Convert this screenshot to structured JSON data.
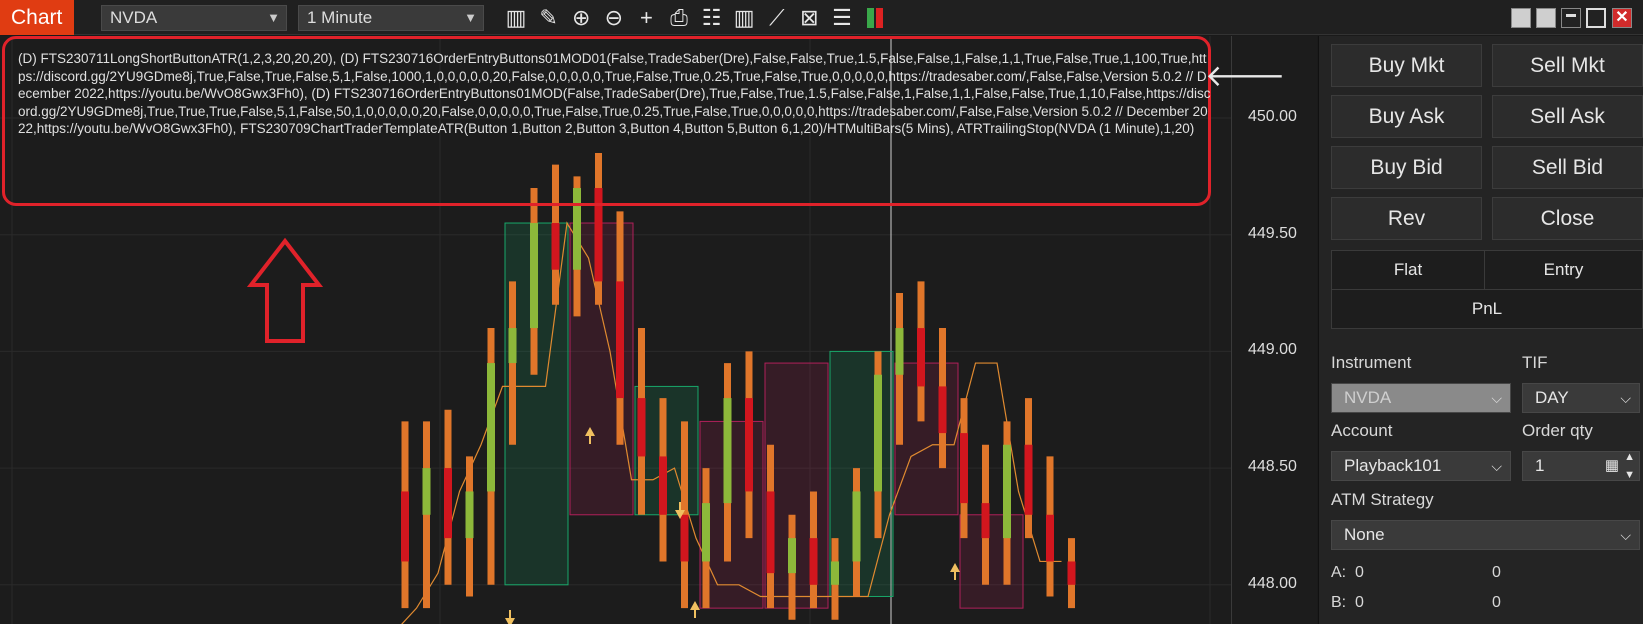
{
  "toolbar": {
    "tab_label": "Chart",
    "instrument": "NVDA",
    "period": "1 Minute",
    "icons": [
      "bar-type-icon",
      "draw-tool-icon",
      "zoom-in-icon",
      "zoom-out-icon",
      "crosshair-icon",
      "data-box-icon",
      "properties-icon",
      "indicators-icon",
      "strategies-icon",
      "templates-icon",
      "object-list-icon",
      "chart-trader-icon"
    ],
    "window_icons": [
      "minimize-icon",
      "restore-icon",
      "maximize-icon",
      "close-icon"
    ],
    "close_glyph": "✕"
  },
  "chart": {
    "indicator_text": "(D) FTS230711LongShortButtonATR(1,2,3,20,20,20), (D) FTS230716OrderEntryButtons01MOD01(False,TradeSaber(Dre),False,False,True,1.5,False,False,1,False,1,1,True,False,True,1,100,True,https://discord.gg/2YU9GDme8j,True,False,True,False,5,1,False,1000,1,0,0,0,0,0,20,False,0,0,0,0,0,True,False,True,0.25,True,False,True,0,0,0,0,0,https://tradesaber.com/,False,False,Version 5.0.2 // December 2022,https://youtu.be/WvO8Gwx3Fh0), (D) FTS230716OrderEntryButtons01MOD(False,TradeSaber(Dre),True,False,True,1.5,False,False,1,False,1,1,False,False,True,1,10,False,https://discord.gg/2YU9GDme8j,True,True,True,False,5,1,False,50,1,0,0,0,0,0,20,False,0,0,0,0,0,True,False,True,0.25,True,False,True,0,0,0,0,0,https://tradesaber.com/,False,False,Version 5.0.2 // December 2022,https://youtu.be/WvO8Gwx3Fh0), FTS230709ChartTraderTemplateATR(Button 1,Button 2,Button 3,Button 4,Button 5,Button 6,1,20)/HTMultiBars(5 Mins), ATRTrailingStop(NVDA (1 Minute),1,20)",
    "arrow_glyph": "🡐",
    "price_ticks": [
      "450.00",
      "449.50",
      "449.00",
      "448.50",
      "448.00"
    ],
    "colors": {
      "up": "#8db83a",
      "down": "#d2161e",
      "wick": "#e0762a",
      "htf_up": "#18a86a",
      "htf_down": "#b0205a",
      "trail": "#e08a30",
      "annotation": "#e0222a"
    }
  },
  "chart_data": {
    "type": "candlestick",
    "y_ticks": [
      450.0,
      449.5,
      449.0,
      448.5,
      448.0
    ],
    "candles": [
      {
        "o": 448.4,
        "h": 448.7,
        "l": 447.9,
        "c": 448.1
      },
      {
        "o": 448.3,
        "h": 448.7,
        "l": 447.9,
        "c": 448.5
      },
      {
        "o": 448.5,
        "h": 448.75,
        "l": 448.0,
        "c": 448.2
      },
      {
        "o": 448.2,
        "h": 448.55,
        "l": 447.95,
        "c": 448.4
      },
      {
        "o": 448.4,
        "h": 449.1,
        "l": 448.0,
        "c": 448.95
      },
      {
        "o": 448.95,
        "h": 449.3,
        "l": 448.6,
        "c": 449.1
      },
      {
        "o": 449.1,
        "h": 449.7,
        "l": 448.9,
        "c": 449.55
      },
      {
        "o": 449.55,
        "h": 449.8,
        "l": 449.2,
        "c": 449.35
      },
      {
        "o": 449.35,
        "h": 449.75,
        "l": 449.15,
        "c": 449.7
      },
      {
        "o": 449.7,
        "h": 449.85,
        "l": 449.2,
        "c": 449.3
      },
      {
        "o": 449.3,
        "h": 449.6,
        "l": 448.6,
        "c": 448.8
      },
      {
        "o": 448.8,
        "h": 449.1,
        "l": 448.3,
        "c": 448.55
      },
      {
        "o": 448.55,
        "h": 448.8,
        "l": 448.1,
        "c": 448.3
      },
      {
        "o": 448.3,
        "h": 448.7,
        "l": 447.9,
        "c": 448.1
      },
      {
        "o": 448.1,
        "h": 448.5,
        "l": 447.9,
        "c": 448.35
      },
      {
        "o": 448.35,
        "h": 448.95,
        "l": 448.1,
        "c": 448.8
      },
      {
        "o": 448.8,
        "h": 449.0,
        "l": 448.2,
        "c": 448.4
      },
      {
        "o": 448.4,
        "h": 448.6,
        "l": 447.9,
        "c": 448.05
      },
      {
        "o": 448.05,
        "h": 448.3,
        "l": 447.85,
        "c": 448.2
      },
      {
        "o": 448.2,
        "h": 448.4,
        "l": 447.9,
        "c": 448.0
      },
      {
        "o": 448.0,
        "h": 448.2,
        "l": 447.85,
        "c": 448.1
      },
      {
        "o": 448.1,
        "h": 448.5,
        "l": 447.95,
        "c": 448.4
      },
      {
        "o": 448.4,
        "h": 449.0,
        "l": 448.2,
        "c": 448.9
      },
      {
        "o": 448.9,
        "h": 449.25,
        "l": 448.6,
        "c": 449.1
      },
      {
        "o": 449.1,
        "h": 449.3,
        "l": 448.7,
        "c": 448.85
      },
      {
        "o": 448.85,
        "h": 449.1,
        "l": 448.5,
        "c": 448.65
      },
      {
        "o": 448.65,
        "h": 448.8,
        "l": 448.2,
        "c": 448.35
      },
      {
        "o": 448.35,
        "h": 448.6,
        "l": 448.0,
        "c": 448.2
      },
      {
        "o": 448.2,
        "h": 448.7,
        "l": 448.0,
        "c": 448.6
      },
      {
        "o": 448.6,
        "h": 448.8,
        "l": 448.2,
        "c": 448.3
      },
      {
        "o": 448.3,
        "h": 448.55,
        "l": 447.95,
        "c": 448.1
      },
      {
        "o": 448.1,
        "h": 448.2,
        "l": 447.9,
        "c": 448.0
      }
    ],
    "htf_bars": [
      {
        "o": 448.0,
        "c": 449.55,
        "up": true
      },
      {
        "o": 449.55,
        "c": 448.3,
        "up": false
      },
      {
        "o": 448.3,
        "c": 448.85,
        "up": true
      },
      {
        "o": 448.7,
        "c": 447.9,
        "up": false
      },
      {
        "o": 447.9,
        "c": 448.95,
        "up": false
      },
      {
        "o": 447.95,
        "c": 449.0,
        "up": true
      },
      {
        "o": 448.95,
        "c": 448.3,
        "up": false
      },
      {
        "o": 448.3,
        "c": 447.9,
        "up": false
      }
    ],
    "trail": [
      447.8,
      447.9,
      448.05,
      448.4,
      448.6,
      448.85,
      448.85,
      448.85,
      449.55,
      449.4,
      449.0,
      448.45,
      448.45,
      448.5,
      448.2,
      448.0,
      448.0,
      447.95,
      447.95,
      447.95,
      447.95,
      447.95,
      447.95,
      448.3,
      448.55,
      448.6,
      448.6,
      448.95,
      448.95,
      448.4,
      448.1,
      448.1
    ]
  },
  "trader": {
    "buttons": {
      "buy_mkt": "Buy Mkt",
      "sell_mkt": "Sell Mkt",
      "buy_ask": "Buy Ask",
      "sell_ask": "Sell Ask",
      "buy_bid": "Buy Bid",
      "sell_bid": "Sell Bid",
      "rev": "Rev",
      "close": "Close"
    },
    "position": {
      "flat": "Flat",
      "entry": "Entry",
      "pnl": "PnL"
    },
    "labels": {
      "instrument": "Instrument",
      "tif": "TIF",
      "account": "Account",
      "order_qty": "Order qty",
      "atm": "ATM Strategy"
    },
    "values": {
      "instrument": "NVDA",
      "tif": "DAY",
      "account": "Playback101",
      "order_qty": "1",
      "atm": "None"
    },
    "stats": {
      "a_label": "A:",
      "a_val1": "0",
      "a_val2": "0",
      "b_label": "B:",
      "b_val1": "0",
      "b_val2": "0"
    },
    "chevron": "⌄"
  }
}
